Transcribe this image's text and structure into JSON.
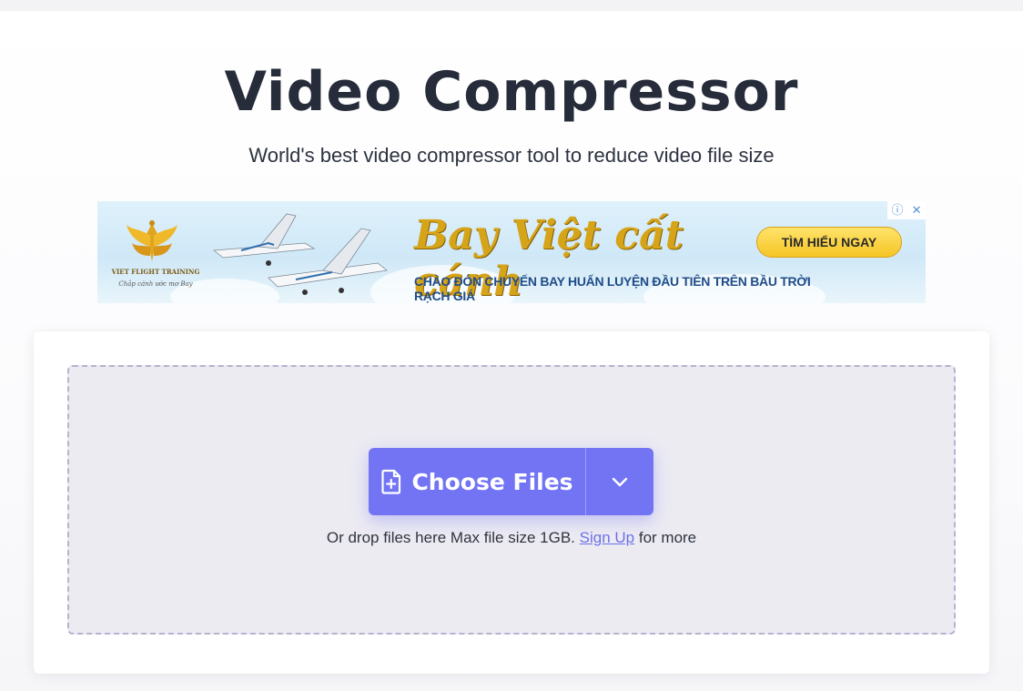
{
  "header": {
    "title": "Video Compressor",
    "subtitle": "World's best video compressor tool to reduce video file size"
  },
  "ad": {
    "brand": "VIET FLIGHT TRAINING",
    "brand_tagline": "Chắp cánh ước mơ Bay",
    "headline": "Bay Việt cất cánh",
    "subline": "CHÀO ĐÓN CHUYẾN BAY HUẤN LUYỆN ĐẦU TIÊN TRÊN BẦU TRỜI RẠCH GIÁ",
    "cta": "TÌM HIỂU NGAY",
    "info_icon": "info-icon",
    "close_icon": "close-icon",
    "accent_gold": "#d6a419",
    "accent_blue": "#1f4c89"
  },
  "upload": {
    "choose_label": "Choose Files",
    "choose_icon": "file-plus-icon",
    "dropdown_icon": "chevron-down-icon",
    "hint_prefix": "Or drop files here Max file size 1GB.",
    "hint_link": "Sign Up",
    "hint_suffix": "for more",
    "button_color": "#7274f3"
  }
}
